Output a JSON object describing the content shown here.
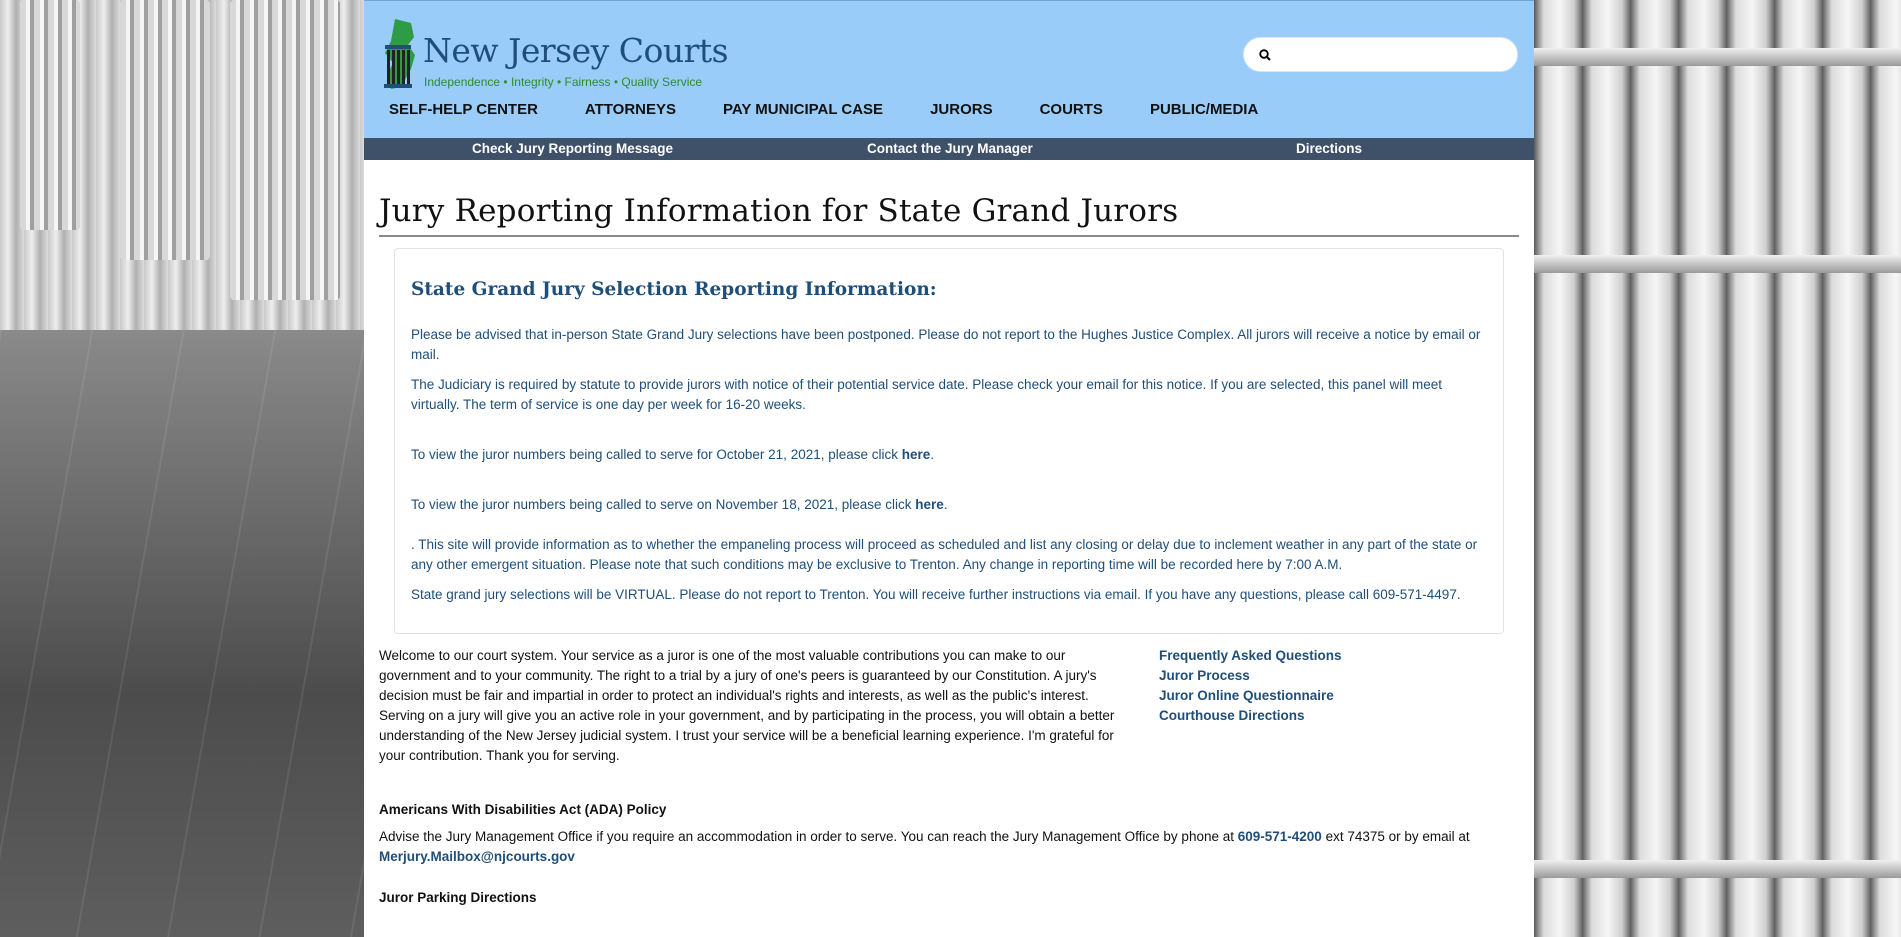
{
  "header": {
    "site_title": "New Jersey Courts",
    "tagline": "Independence • Integrity • Fairness • Quality Service",
    "search_placeholder": ""
  },
  "main_nav": [
    {
      "label": "SELF-HELP CENTER"
    },
    {
      "label": "ATTORNEYS"
    },
    {
      "label": "PAY MUNICIPAL CASE"
    },
    {
      "label": "JURORS"
    },
    {
      "label": "COURTS"
    },
    {
      "label": "PUBLIC/MEDIA"
    }
  ],
  "sub_nav": [
    {
      "label": "Check Jury Reporting Message"
    },
    {
      "label": "Contact the Jury Manager"
    },
    {
      "label": "Directions"
    }
  ],
  "page_title": "Jury Reporting Information for State Grand Jurors",
  "notice": {
    "heading": "State Grand Jury Selection Reporting Information:",
    "p1": "Please be advised that in-person State Grand Jury selections have been postponed. Please do not report to the Hughes Justice Complex. All jurors will receive a notice by email or mail.",
    "p2": "The Judiciary is required by statute to provide jurors with notice of their potential service date. Please check your email for this notice. If you are selected, this panel will meet virtually. The term of service is one day per week for 16-20 weeks.",
    "p3_text": "To view the juror numbers being called to serve for October 21, 2021, please click ",
    "p3_link": "here",
    "p3_end": ".",
    "p4_text": "To view the juror numbers being called to serve on November 18, 2021, please click ",
    "p4_link": "here",
    "p4_end": ".",
    "p5": ". This site will provide information as to whether the empaneling process will proceed as scheduled and list any closing or delay due to inclement weather in any part of the state or any other emergent situation. Please note that such conditions may be exclusive to Trenton. Any change in reporting time will be recorded here by 7:00 A.M.",
    "p6": "State grand jury selections will be VIRTUAL. Please do not report to Trenton. You will receive further instructions via email. If you have any questions, please call 609-571-4497."
  },
  "welcome": "Welcome to our court system. Your service as a juror is one of the most valuable contributions you can make to our government and to your community. The right to a trial by a jury of one's peers is guaranteed by our Constitution. A jury's decision must be fair and impartial in order to protect an individual's rights and interests, as well as the public's interest. Serving on a jury will give you an active role in your government, and by participating in the process, you will obtain a better understanding of the New Jersey judicial system. I trust your service will be a beneficial learning experience. I'm grateful for your contribution. Thank you for serving.",
  "quick_links": [
    {
      "label": "Frequently Asked Questions"
    },
    {
      "label": "Juror Process"
    },
    {
      "label": "Juror Online Questionnaire"
    },
    {
      "label": "Courthouse Directions"
    }
  ],
  "ada": {
    "heading": "Americans With Disabilities Act (ADA) Policy",
    "text_before": "Advise the Jury Management Office if you require an accommodation in order to serve. You can reach the Jury Management Office by phone at ",
    "phone": "609-571-4200",
    "text_mid": " ext 74375 or by email at ",
    "email": "Merjury.Mailbox@njcourts.gov"
  },
  "parking_heading": "Juror Parking Directions",
  "colors": {
    "header_bg": "#99ccf9",
    "subnav_bg": "#3f5069",
    "link_blue": "#1f4e79",
    "logo_green": "#2d8c2d"
  }
}
